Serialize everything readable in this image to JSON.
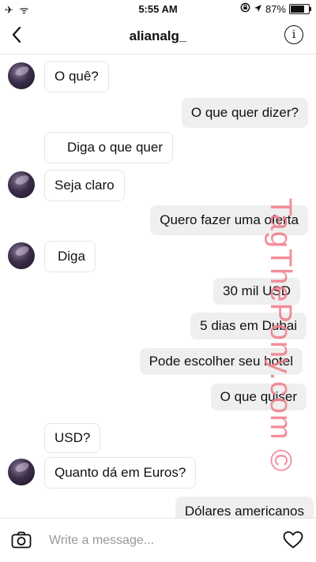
{
  "status_bar": {
    "left_icons": "✈ ᯤ",
    "time": "5:55 AM",
    "lock_icon": "lock-rotation-icon",
    "location_icon": "location-arrow-icon",
    "battery_text": "87%",
    "battery_level": 0.87
  },
  "header": {
    "title": "alianalg_",
    "back_icon": "chevron-left-icon",
    "info_icon": "info-icon",
    "info_glyph": "i"
  },
  "messages": [
    {
      "side": "in",
      "text": "O quê?",
      "avatar": true
    },
    {
      "side": "out",
      "text": "O que quer dizer?"
    },
    {
      "side": "in",
      "text": "Diga o que quer",
      "avatar": false
    },
    {
      "side": "in",
      "text": "Seja claro",
      "avatar": true
    },
    {
      "side": "out",
      "text": "Quero fazer uma oferta"
    },
    {
      "side": "in",
      "text": "Diga",
      "avatar": true
    },
    {
      "side": "out",
      "text": "30 mil USD"
    },
    {
      "side": "out",
      "text": "5 dias em Dubai"
    },
    {
      "side": "out",
      "text": "Pode escolher seu hotel"
    },
    {
      "side": "out",
      "text": "O que quiser"
    },
    {
      "side": "in",
      "text": "USD?",
      "avatar": false
    },
    {
      "side": "in",
      "text": "Quanto dá em Euros?",
      "avatar": true
    },
    {
      "side": "out",
      "text": "Dólares americanos"
    }
  ],
  "watermark": "TagThePony.com ©",
  "composer": {
    "placeholder": "Write a message...",
    "camera_icon": "camera-icon",
    "heart_icon": "heart-icon"
  },
  "colors": {
    "incoming_bubble": "#ffffff",
    "outgoing_bubble": "#efefef",
    "watermark": "#f07b8a"
  }
}
